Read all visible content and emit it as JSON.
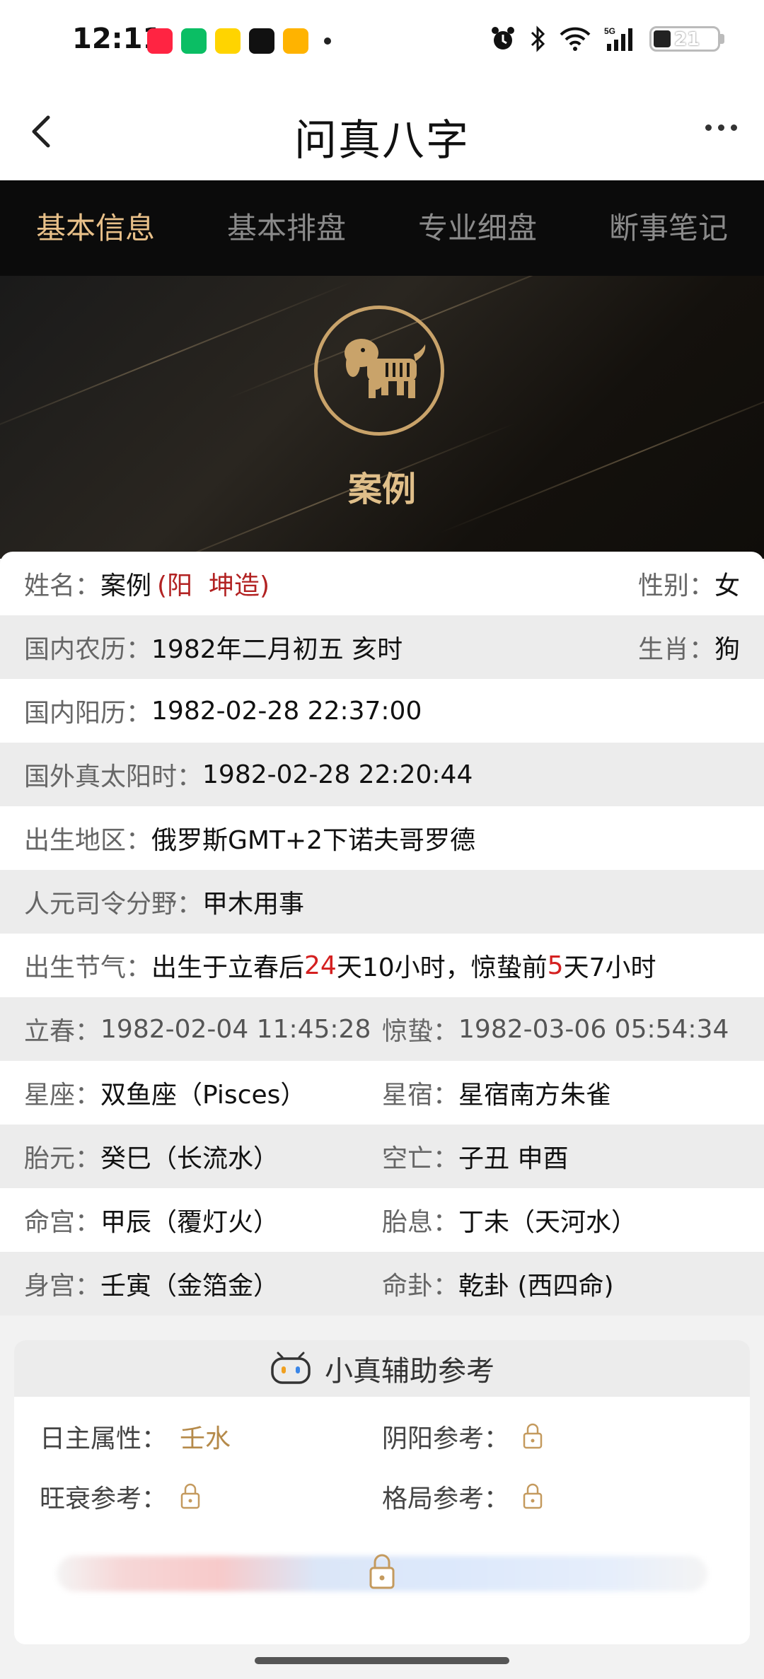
{
  "status_bar": {
    "time": "12:11",
    "app_icons": [
      "小红书",
      "爱奇艺",
      "喵喵",
      "抖音",
      "视频"
    ],
    "battery": "21",
    "network": "5G"
  },
  "header": {
    "title": "问真八字"
  },
  "tabs": [
    {
      "label": "基本信息",
      "active": true
    },
    {
      "label": "基本排盘",
      "active": false
    },
    {
      "label": "专业细盘",
      "active": false
    },
    {
      "label": "断事笔记",
      "active": false
    }
  ],
  "hero": {
    "name": "案例"
  },
  "info": {
    "name_label": "姓名：",
    "name_value": "案例",
    "name_tag": "(阳  坤造)",
    "gender_label": "性别：",
    "gender_value": "女",
    "lunar_label": "国内农历：",
    "lunar_value": "1982年二月初五 亥时",
    "zodiac_label": "生肖：",
    "zodiac_value": "狗",
    "solar_label": "国内阳历：",
    "solar_value": "1982-02-28 22:37:00",
    "true_solar_label": "国外真太阳时：",
    "true_solar_value": "1982-02-28 22:20:44",
    "region_label": "出生地区：",
    "region_value": "俄罗斯GMT+2下诺夫哥罗德",
    "siling_label": "人元司令分野：",
    "siling_value": "甲木用事",
    "jieqi_label": "出生节气：",
    "jieqi_p1": "出生于立春后",
    "jieqi_n1": "24",
    "jieqi_p2": "天10小时，惊蛰前",
    "jieqi_n2": "5",
    "jieqi_p3": "天7小时",
    "lichun_label": "立春：",
    "lichun_value": "1982-02-04 11:45:28",
    "jingzhe_label": "惊蛰：",
    "jingzhe_value": "1982-03-06 05:54:34",
    "xingzuo_label": "星座：",
    "xingzuo_value": "双鱼座（Pisces）",
    "xingxiu_label": "星宿：",
    "xingxiu_value": "星宿南方朱雀",
    "taiyuan_label": "胎元：",
    "taiyuan_value": "癸巳（长流水）",
    "kongwang_label": "空亡：",
    "kongwang_value": "子丑 申酉",
    "minggong_label": "命宫：",
    "minggong_value": "甲辰（覆灯火）",
    "taixi_label": "胎息：",
    "taixi_value": "丁未（天河水）",
    "shengong_label": "身宫：",
    "shengong_value": "壬寅（金箔金）",
    "minggua_label": "命卦：",
    "minggua_value": "乾卦 (西四命)"
  },
  "assistant": {
    "title": "小真辅助参考",
    "rizhu_label": "日主属性：",
    "rizhu_value": "壬水",
    "yinyang_label": "阴阳参考：",
    "wangshuai_label": "旺衰参考：",
    "geju_label": "格局参考："
  },
  "colors": {
    "accent_gold": "#e8c089",
    "tab_bg": "#0b0b0b",
    "red": "#b22222"
  }
}
